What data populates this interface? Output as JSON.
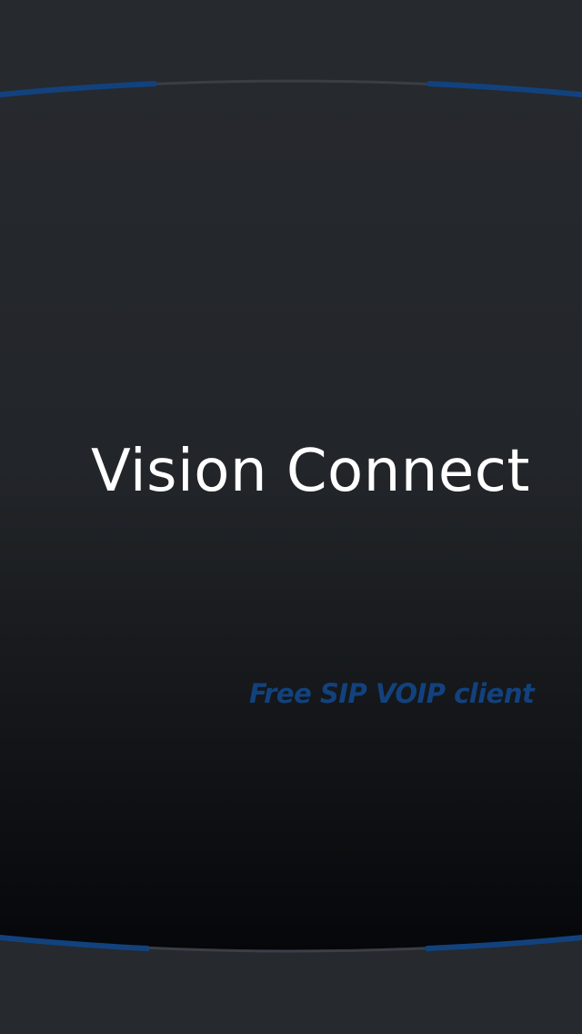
{
  "splash": {
    "app_title": "Vision Connect",
    "tagline": "Free SIP VOIP client"
  },
  "colors": {
    "background": "#26292e",
    "panel_top": "#26292e",
    "panel_bottom": "#07080a",
    "accent_blue": "#12427e",
    "title_text": "#ffffff",
    "edge_line": "#3a3e45"
  }
}
